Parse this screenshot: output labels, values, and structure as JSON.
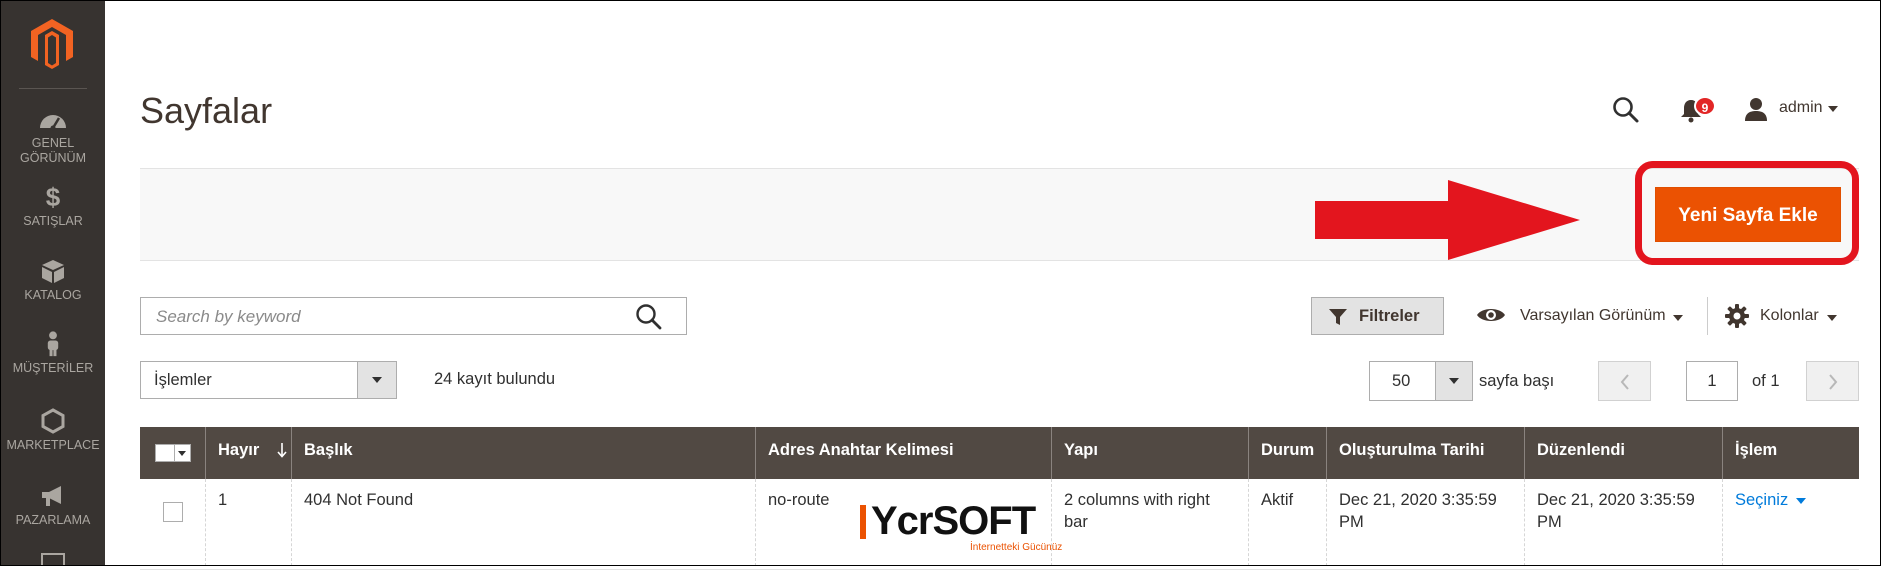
{
  "sidebar": {
    "logo": "magento-logo-icon",
    "items": [
      {
        "label_line1": "GENEL",
        "label_line2": "GÖRÜNÜM",
        "icon": "dashboard-icon"
      },
      {
        "label_line1": "SATIŞLAR",
        "icon": "dollar-icon"
      },
      {
        "label_line1": "KATALOG",
        "icon": "cube-icon"
      },
      {
        "label_line1": "MÜŞTERİLER",
        "icon": "person-icon"
      },
      {
        "label_line1": "MARKETPLACE",
        "icon": "hexagon-icon"
      },
      {
        "label_line1": "PAZARLAMA",
        "icon": "megaphone-icon"
      }
    ]
  },
  "header": {
    "title": "Sayfalar",
    "notification_count": "9",
    "user_label": "admin"
  },
  "actions_bar": {
    "add_button_label": "Yeni Sayfa Ekle",
    "highlight_color": "#e3151e",
    "arrow_color": "#e3151e"
  },
  "toolbar": {
    "search_placeholder": "Search by keyword",
    "filters_label": "Filtreler",
    "view_label": "Varsayılan Görünüm",
    "columns_label": "Kolonlar",
    "actions_label": "İşlemler",
    "records_text": "24 kayıt bulundu",
    "per_page_value": "50",
    "per_page_label": "sayfa başı",
    "page_value": "1",
    "page_of": "of 1"
  },
  "grid": {
    "columns": [
      "Hayır",
      "Başlık",
      "Adres Anahtar Kelimesi",
      "Yapı",
      "Durum",
      "Oluşturulma Tarihi",
      "Düzenlendi",
      "İşlem"
    ],
    "rows": [
      {
        "id": "1",
        "title": "404 Not Found",
        "url_key": "no-route",
        "layout": "2 columns with right bar",
        "status": "Aktif",
        "created": "Dec 21, 2020 3:35:59 PM",
        "modified": "Dec 21, 2020 3:35:59 PM",
        "action": "Seçiniz"
      }
    ]
  },
  "watermark": {
    "brand": "YcrSOFT",
    "tagline": "İnternetteki Gücünüz"
  },
  "colors": {
    "sidebar_bg": "#373330",
    "primary_button": "#eb5202",
    "grid_header": "#514943",
    "link": "#007bdb"
  }
}
